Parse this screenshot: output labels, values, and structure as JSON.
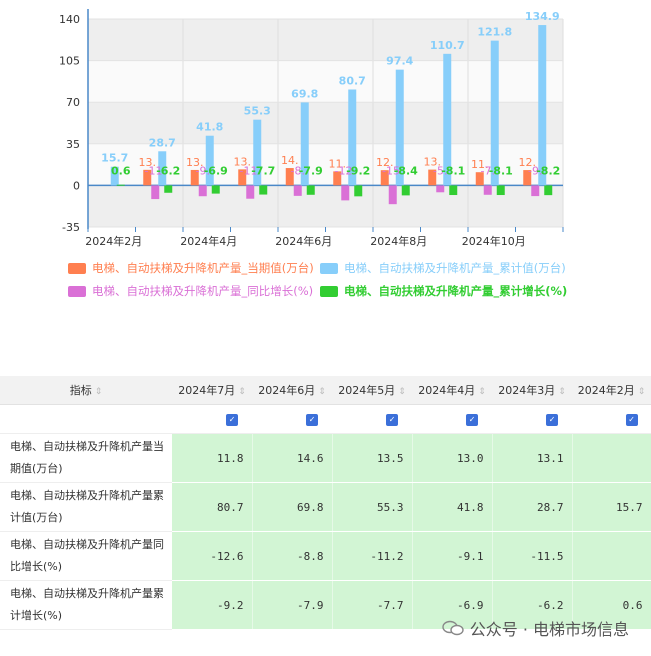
{
  "chart_data": {
    "type": "bar",
    "categories": [
      "2024年2月",
      "2024年3月",
      "2024年4月",
      "2024年5月",
      "2024年6月",
      "2024年7月",
      "2024年8月",
      "2024年9月",
      "2024年10月",
      "2024年11月"
    ],
    "x_tick_labels": [
      "2024年2月",
      "2024年4月",
      "2024年6月",
      "2024年8月",
      "2024年10月"
    ],
    "y_ticks": [
      "140",
      "105",
      "70",
      "35",
      "0",
      "-35"
    ],
    "ylim": [
      -35,
      140
    ],
    "series": [
      {
        "name": "电梯、自动扶梯及升降机产量_当期值(万台)",
        "color": "#ff7f50",
        "values": [
          null,
          13.1,
          13.0,
          13.5,
          14.6,
          11.8,
          12.8,
          13.3,
          11.1,
          12.9
        ],
        "labels": [
          "",
          "13.",
          "13.",
          "13.",
          "14.",
          "11.",
          "12.",
          "13.",
          "11.",
          "12."
        ]
      },
      {
        "name": "电梯、自动扶梯及升降机产量_累计值(万台)",
        "color": "#87cefa",
        "values": [
          15.7,
          28.7,
          41.8,
          55.3,
          69.8,
          80.7,
          97.4,
          110.7,
          121.8,
          134.9
        ],
        "labels": [
          "15.7",
          "28.7",
          "41.8",
          "55.3",
          "69.8",
          "80.7",
          "97.4",
          "110.7",
          "121.8",
          "134.9"
        ]
      },
      {
        "name": "电梯、自动扶梯及升降机产量_同比增长(%)",
        "color": "#da70d6",
        "values": [
          null,
          -11.5,
          -9.1,
          -11.2,
          -8.8,
          -12.6,
          -15.8,
          -5.8,
          -7.9,
          -9.0
        ],
        "labels": [
          "",
          "-11.",
          "-9.",
          "-11.",
          "-8.",
          "-12.",
          "-15.",
          "-5.",
          "-7.",
          "-9."
        ]
      },
      {
        "name": "电梯、自动扶梯及升降机产量_累计增长(%)",
        "color": "#32cd32",
        "values": [
          0.6,
          -6.2,
          -6.9,
          -7.7,
          -7.9,
          -9.2,
          -8.4,
          -8.1,
          -8.1,
          -8.2
        ],
        "labels": [
          "0.6",
          "-6.2",
          "-6.9",
          "-7.7",
          "-7.9",
          "-9.2",
          "-8.4",
          "-8.1",
          "-8.1",
          "-8.2"
        ]
      }
    ]
  },
  "table": {
    "header_label": "指标",
    "columns": [
      "2024年7月",
      "2024年6月",
      "2024年5月",
      "2024年4月",
      "2024年3月",
      "2024年2月"
    ],
    "rows": [
      {
        "name": "电梯、自动扶梯及升降机产量当期值(万台)",
        "values": [
          "11.8",
          "14.6",
          "13.5",
          "13.0",
          "13.1",
          ""
        ]
      },
      {
        "name": "电梯、自动扶梯及升降机产量累计值(万台)",
        "values": [
          "80.7",
          "69.8",
          "55.3",
          "41.8",
          "28.7",
          "15.7"
        ]
      },
      {
        "name": "电梯、自动扶梯及升降机产量同比增长(%)",
        "values": [
          "-12.6",
          "-8.8",
          "-11.2",
          "-9.1",
          "-11.5",
          ""
        ]
      },
      {
        "name": "电梯、自动扶梯及升降机产量累计增长(%)",
        "values": [
          "-9.2",
          "-7.9",
          "-7.7",
          "-6.9",
          "-6.2",
          "0.6"
        ]
      }
    ]
  },
  "watermark": {
    "text": "公众号 · 电梯市场信息"
  }
}
